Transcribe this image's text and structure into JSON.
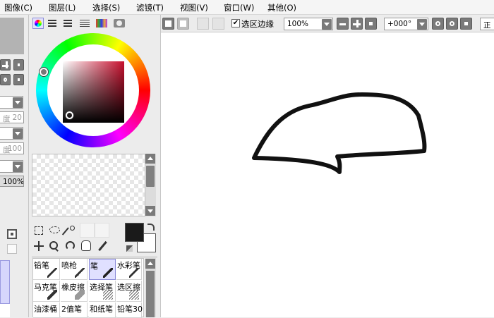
{
  "menubar": {
    "items": [
      "图像(C)",
      "图层(L)",
      "选择(S)",
      "滤镜(T)",
      "视图(V)",
      "窗口(W)",
      "其他(O)"
    ]
  },
  "left_panel": {
    "density_label": "度",
    "density_value": "20",
    "opacity_label": "度",
    "opacity_value": "100",
    "percent_value": "100%"
  },
  "color_panel": {
    "mode_icons": [
      "color-wheel-icon",
      "rgb-sliders-icon",
      "hsv-sliders-icon",
      "swatches-list-icon",
      "swatch-grid-icon",
      "scratchpad-icon"
    ],
    "hue_marker_color": "#ff0000",
    "primary_color": "#1a1a1a",
    "secondary_color": "#ffffff"
  },
  "toolbar": {
    "selection_edge_label": "选区边缘",
    "selection_edge_checked": true,
    "zoom_value": "100%",
    "rotation_value": "+000°",
    "right_label": "正"
  },
  "tool_palette": {
    "row1": [
      {
        "label": "铅笔",
        "active": false
      },
      {
        "label": "喷枪",
        "active": false
      },
      {
        "label": "笔",
        "active": true
      },
      {
        "label": "水彩笔",
        "active": false
      }
    ],
    "row2": [
      {
        "label": "马克笔",
        "active": false
      },
      {
        "label": "橡皮擦",
        "active": false
      },
      {
        "label": "选择笔",
        "active": false
      },
      {
        "label": "选区擦",
        "active": false
      }
    ],
    "row3": [
      {
        "label": "油漆桶",
        "active": false
      },
      {
        "label": "2值笔",
        "active": false
      },
      {
        "label": "和纸笔",
        "active": false
      },
      {
        "label": "铅笔30",
        "active": false
      }
    ]
  },
  "canvas": {
    "background": "#ffffff",
    "stroke_color": "#111111"
  }
}
